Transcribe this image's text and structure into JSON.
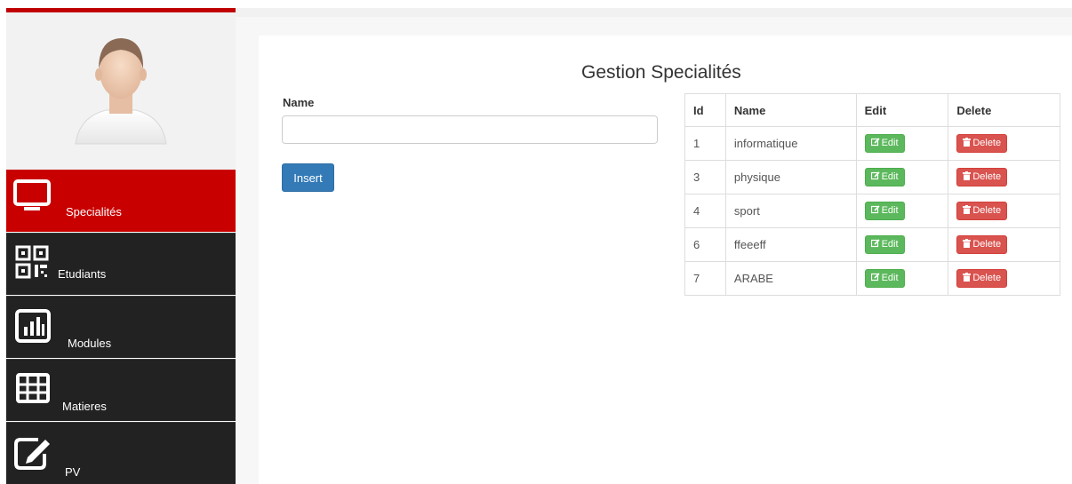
{
  "colors": {
    "accent_red": "#c90000",
    "sidebar_dark": "#222222",
    "primary_blue": "#337ab7",
    "success_green": "#5cb85c",
    "danger_red": "#d9534f"
  },
  "sidebar": {
    "avatar_icon": "user-avatar-icon",
    "items": [
      {
        "label": "Specialités",
        "icon": "monitor-icon",
        "active": true
      },
      {
        "label": "Etudiants",
        "icon": "qr-code-icon",
        "active": false
      },
      {
        "label": "Modules",
        "icon": "bar-chart-icon",
        "active": false
      },
      {
        "label": "Matieres",
        "icon": "grid-table-icon",
        "active": false
      },
      {
        "label": "PV",
        "icon": "edit-square-icon",
        "active": false
      }
    ]
  },
  "main": {
    "title": "Gestion Specialités",
    "form": {
      "name_label": "Name",
      "name_value": "",
      "name_placeholder": "",
      "insert_label": "Insert"
    },
    "table": {
      "headers": {
        "id": "Id",
        "name": "Name",
        "edit": "Edit",
        "delete": "Delete"
      },
      "edit_label": "Edit",
      "delete_label": "Delete",
      "rows": [
        {
          "id": "1",
          "name": "informatique"
        },
        {
          "id": "3",
          "name": "physique"
        },
        {
          "id": "4",
          "name": "sport"
        },
        {
          "id": "6",
          "name": "ffeeeff"
        },
        {
          "id": "7",
          "name": "ARABE"
        }
      ]
    }
  }
}
